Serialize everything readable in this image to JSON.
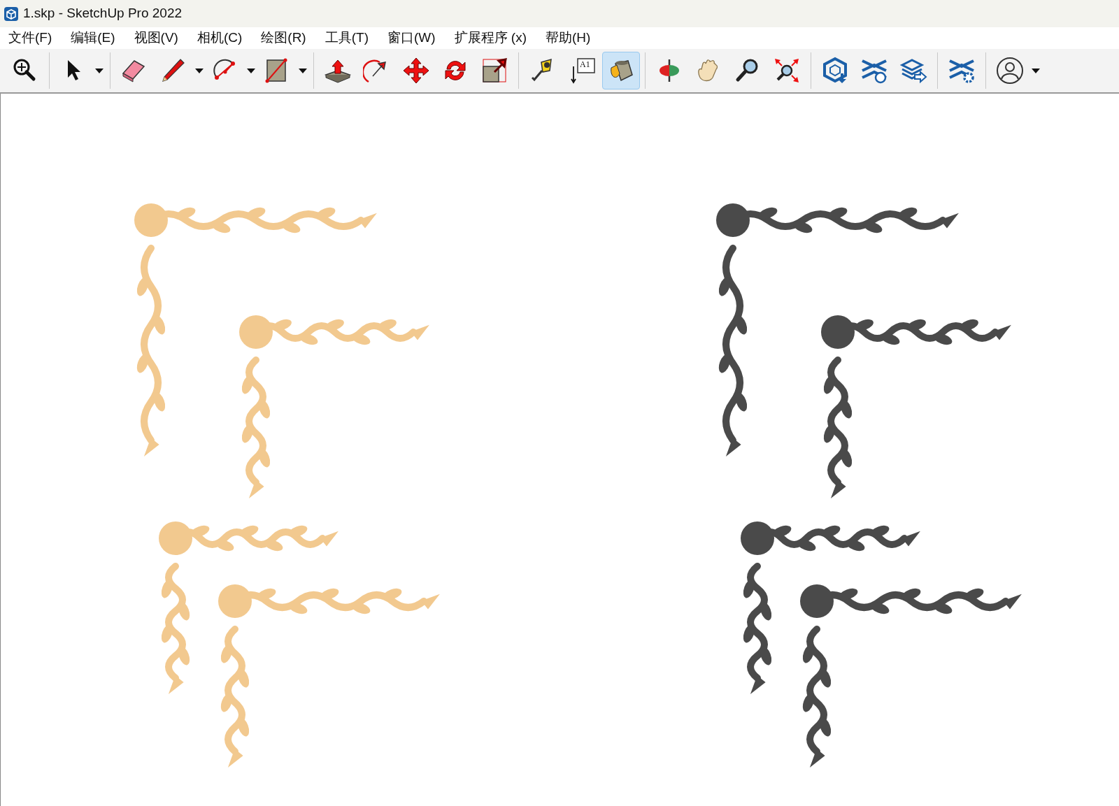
{
  "window": {
    "title": "1.skp - SketchUp Pro 2022"
  },
  "menu": [
    "文件(F)",
    "编辑(E)",
    "视图(V)",
    "相机(C)",
    "绘图(R)",
    "工具(T)",
    "窗口(W)",
    "扩展程序 (x)",
    "帮助(H)"
  ],
  "toolbar": {
    "groups": [
      [
        {
          "selected": false,
          "dropdown": false
        }
      ],
      [
        {
          "selected": false,
          "dropdown": true
        }
      ],
      [
        {
          "selected": false,
          "dropdown": false
        },
        {
          "selected": false,
          "dropdown": true
        },
        {
          "selected": false,
          "dropdown": true
        },
        {
          "selected": false,
          "dropdown": true
        }
      ],
      [
        {
          "selected": false,
          "dropdown": false
        },
        {
          "selected": false,
          "dropdown": false
        },
        {
          "selected": false,
          "dropdown": false
        },
        {
          "selected": false,
          "dropdown": false
        },
        {
          "selected": false,
          "dropdown": false
        }
      ],
      [
        {
          "selected": false,
          "dropdown": false
        },
        {
          "selected": false,
          "dropdown": false,
          "label": "A1"
        },
        {
          "selected": true,
          "dropdown": false
        }
      ],
      [
        {
          "selected": false,
          "dropdown": false
        },
        {
          "selected": false,
          "dropdown": false
        },
        {
          "selected": false,
          "dropdown": false
        },
        {
          "selected": false,
          "dropdown": false
        }
      ],
      [
        {
          "selected": false,
          "dropdown": false
        },
        {
          "selected": false,
          "dropdown": false
        },
        {
          "selected": false,
          "dropdown": false
        }
      ],
      [
        {
          "selected": false,
          "dropdown": false
        }
      ],
      [
        {
          "selected": false,
          "dropdown": true
        }
      ]
    ]
  },
  "viewport": {
    "models": [
      {
        "color": "#f2c98f"
      },
      {
        "color": "#f2c98f"
      },
      {
        "color": "#f2c98f"
      },
      {
        "color": "#f2c98f"
      },
      {
        "color": "#4a4a4a"
      },
      {
        "color": "#4a4a4a"
      },
      {
        "color": "#4a4a4a"
      },
      {
        "color": "#4a4a4a"
      }
    ]
  }
}
